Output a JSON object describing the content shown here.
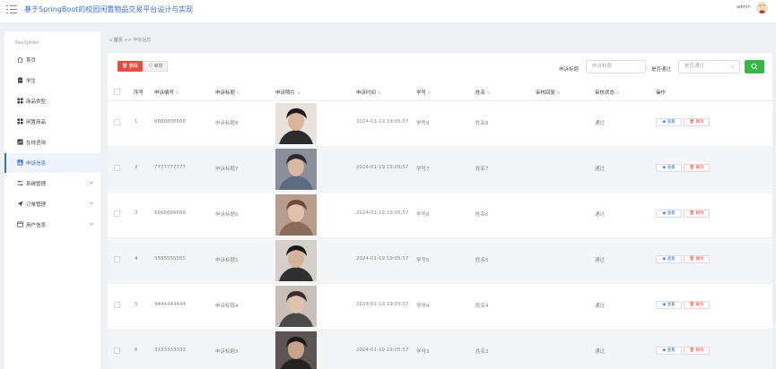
{
  "header": {
    "title": "基于SpringBoot的校园闲置物品交易平台设计与实现",
    "user_name": "admin"
  },
  "sidebar": {
    "caption": "Navigation",
    "items": [
      {
        "label": "首页",
        "icon": "home-icon",
        "active": false,
        "expandable": false
      },
      {
        "label": "学生",
        "icon": "student-icon",
        "active": false,
        "expandable": false
      },
      {
        "label": "商品类型",
        "icon": "grid-icon",
        "active": false,
        "expandable": false
      },
      {
        "label": "闲置商品",
        "icon": "grid-icon",
        "active": false,
        "expandable": false
      },
      {
        "label": "在线咨询",
        "icon": "chart-icon",
        "active": false,
        "expandable": false
      },
      {
        "label": "申诉信息",
        "icon": "chart-icon",
        "active": true,
        "expandable": false
      },
      {
        "label": "系统管理",
        "icon": "sliders-icon",
        "active": false,
        "expandable": true
      },
      {
        "label": "订单管理",
        "icon": "send-icon",
        "active": false,
        "expandable": true
      },
      {
        "label": "用户信息",
        "icon": "window-icon",
        "active": false,
        "expandable": true
      }
    ]
  },
  "breadcrumb": {
    "home": "首页",
    "separator": ">>",
    "current": "申诉信息"
  },
  "toolbar": {
    "delete_label": "删除",
    "audit_label": "审核"
  },
  "search": {
    "title_label": "申诉标题",
    "title_placeholder": "申诉标题",
    "status_label": "是否通过",
    "status_placeholder": "是否通过"
  },
  "table": {
    "columns": [
      "序号",
      "申诉编号",
      "申诉标题",
      "申诉照片",
      "申诉时间",
      "学号",
      "姓名",
      "审核回复",
      "审核状态",
      "操作"
    ],
    "view_label": "查看",
    "delete_label": "删除",
    "rows": [
      {
        "index": "1",
        "code": "8888888888",
        "title": "申诉标题8",
        "time": "2024-01-19 19:05:57",
        "student_no": "学号8",
        "name": "姓名8",
        "reply": "",
        "status": "通过"
      },
      {
        "index": "2",
        "code": "7777777777",
        "title": "申诉标题7",
        "time": "2024-01-19 19:05:57",
        "student_no": "学号7",
        "name": "姓名7",
        "reply": "",
        "status": "通过"
      },
      {
        "index": "3",
        "code": "6666666666",
        "title": "申诉标题6",
        "time": "2024-01-19 19:05:57",
        "student_no": "学号6",
        "name": "姓名6",
        "reply": "",
        "status": "通过"
      },
      {
        "index": "4",
        "code": "5555555555",
        "title": "申诉标题5",
        "time": "2024-01-19 19:05:57",
        "student_no": "学号5",
        "name": "姓名5",
        "reply": "",
        "status": "通过"
      },
      {
        "index": "5",
        "code": "4444444444",
        "title": "申诉标题4",
        "time": "2024-01-19 19:05:57",
        "student_no": "学号4",
        "name": "姓名4",
        "reply": "",
        "status": "通过"
      },
      {
        "index": "6",
        "code": "3333333333",
        "title": "申诉标题3",
        "time": "2024-01-19 19:05:57",
        "student_no": "学号3",
        "name": "姓名3",
        "reply": "",
        "status": "通过"
      }
    ]
  },
  "colors": {
    "accent": "#3a6fd8",
    "danger": "#e54d42",
    "success": "#39b54a"
  }
}
